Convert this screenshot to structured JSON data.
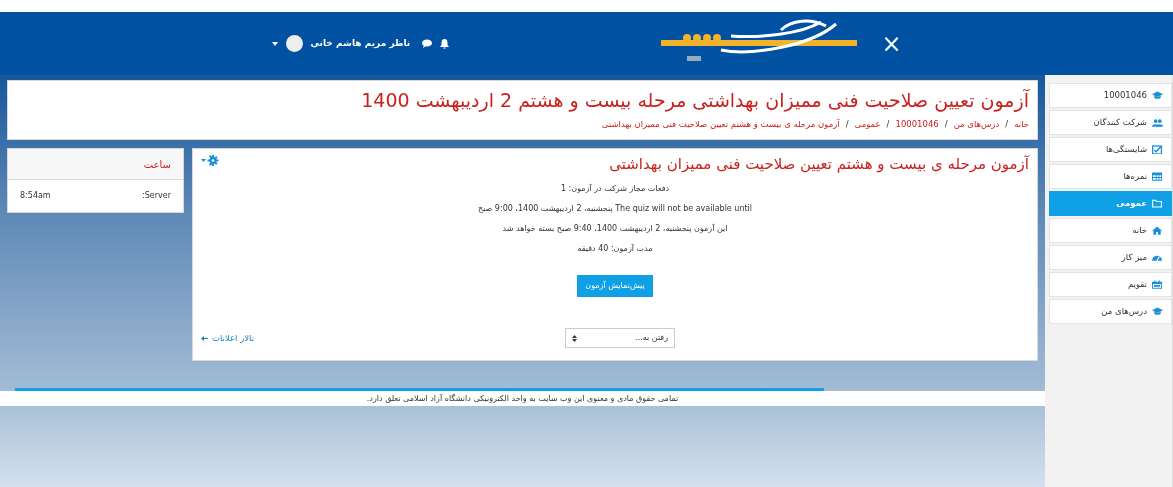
{
  "navbar": {
    "close": "×",
    "user_name": "ناظر مریم هاشم خانی"
  },
  "sidebar": {
    "items": [
      {
        "kind": "cap",
        "label": "10001046",
        "selected": false
      },
      {
        "kind": "users",
        "label": "شرکت کنندگان",
        "selected": false
      },
      {
        "kind": "check",
        "label": "شایستگی‌ها",
        "selected": false
      },
      {
        "kind": "grid",
        "label": "نمره‌ها",
        "selected": false
      },
      {
        "kind": "folder",
        "label": "عمومی",
        "selected": true
      },
      {
        "kind": "home",
        "label": "خانه",
        "selected": false
      },
      {
        "kind": "gauge",
        "label": "میز کار",
        "selected": false
      },
      {
        "kind": "calendar",
        "label": "تقویم",
        "selected": false
      },
      {
        "kind": "cap",
        "label": "درس‌های من",
        "selected": false
      }
    ]
  },
  "course_header": {
    "title": "آزمون تعیین صلاحیت فنی ممیزان بهداشتی مرحله بیست و هشتم 2 اردیبهشت 1400",
    "breadcrumb": [
      {
        "label": "خانه",
        "separator": "/"
      },
      {
        "label": "درس‌های من",
        "separator": "/"
      },
      {
        "label": "10001046",
        "separator": "/"
      },
      {
        "label": "عمومی",
        "separator": "/"
      },
      {
        "label": "آزمون مرحله ی بیست و هشتم تعیین صلاحیت فنی ممیزان بهداشتی"
      }
    ]
  },
  "quiz": {
    "title": "آزمون مرحله ی بیست و هشتم تعیین صلاحیت فنی ممیزان بهداشتی",
    "info": [
      "دفعات مجاز شرکت در آزمون: 1",
      "The quiz will not be available until پنجشنبه، 2 اردیبهشت 1400، 9:00 صبح",
      "این آزمون پنجشنبه، 2 اردیبهشت 1400، 9:40 صبح بسته خواهد شد",
      "مدت آزمون: 40 دقیقه"
    ],
    "button": "پیش‌نمایش آزمون",
    "jump_select": {
      "value": "رفتن به..."
    },
    "forum_link": "تالار اعلانات"
  },
  "clock_block": {
    "title": "ساعت",
    "label": "Server:",
    "time": "8:54am"
  },
  "footer": {
    "text": "تمامی حقوق مادی و معنوی این وب سایت به واحد الکترونیکی دانشگاه آزاد اسلامی تعلق دارد."
  }
}
